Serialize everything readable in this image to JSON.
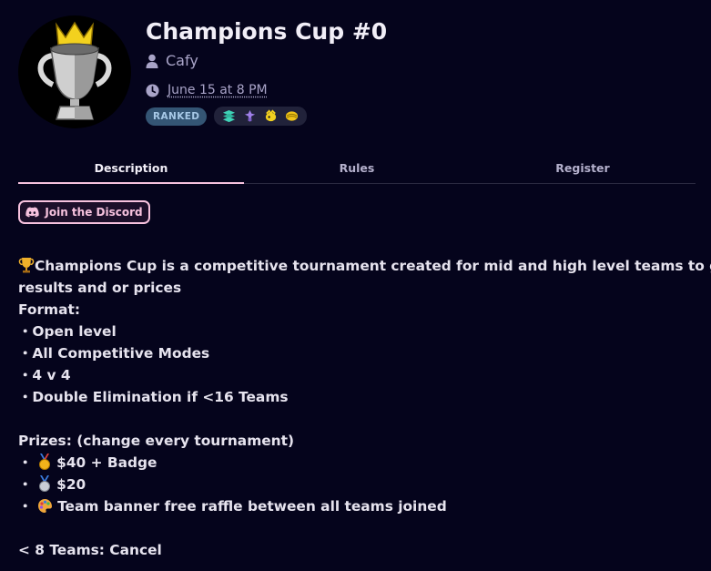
{
  "tournament": {
    "title": "Champions Cup #0",
    "organizer": "Cafy",
    "time": "June 15 at 8 PM",
    "badge": "RANKED",
    "mode_icons": [
      "splat-zones-icon",
      "tower-control-icon",
      "rainmaker-icon",
      "clam-blitz-icon"
    ]
  },
  "tabs": [
    "Description",
    "Rules",
    "Register"
  ],
  "discord": {
    "label": "Join the Discord"
  },
  "description": {
    "intro_line1": "Champions Cup is a competitive tournament created for mid and high level teams to get",
    "intro_line2": "results and or prices",
    "format_heading": "Format:",
    "format_items": [
      "Open level",
      "All Competitive Modes",
      "4 v 4",
      "Double Elimination if <16 Teams"
    ],
    "prizes_heading": "Prizes: (change every tournament)",
    "prizes": [
      "$40 + Badge",
      "$20",
      "Team banner free raffle between all teams joined"
    ],
    "footer": "< 8 Teams: Cancel"
  },
  "colors": {
    "background": "#05041c",
    "accent_pink": "#f7c2de",
    "ranked_badge": "#345574"
  }
}
